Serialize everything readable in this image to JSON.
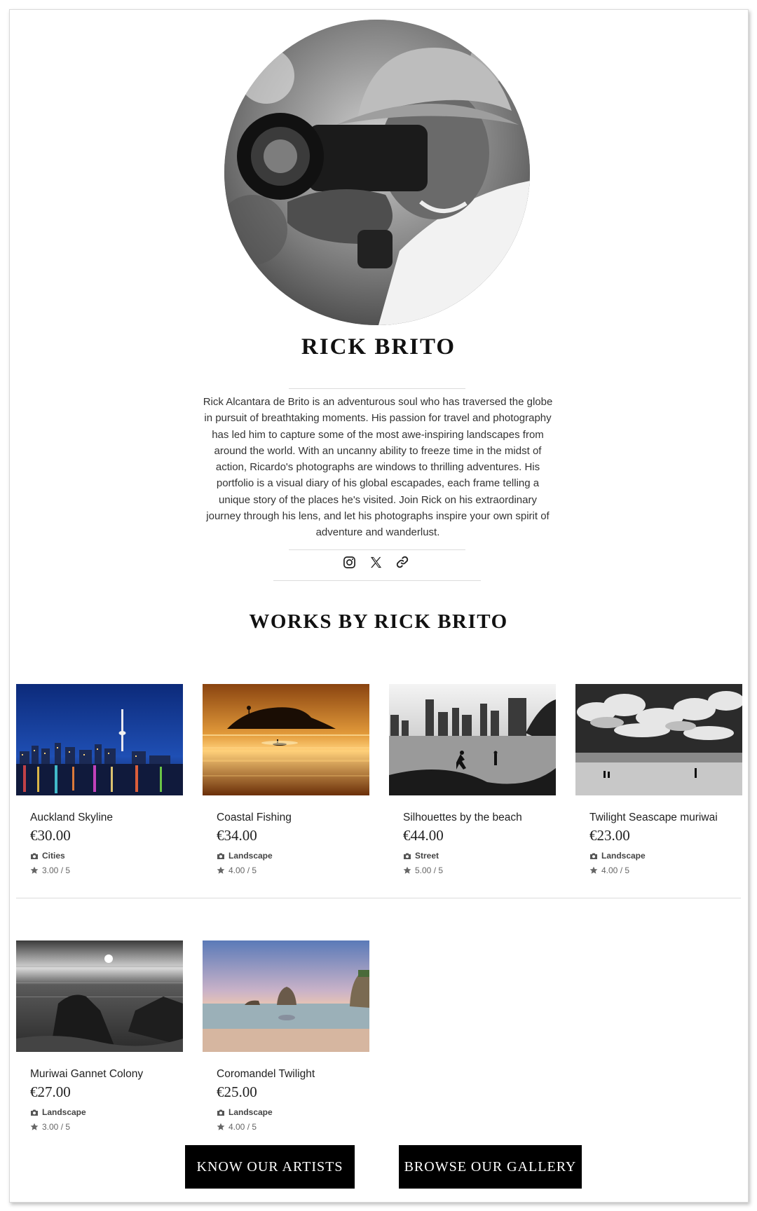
{
  "artist": {
    "name": "RICK BRITO",
    "bio": "Rick Alcantara de Brito is an adventurous soul who has traversed the globe in pursuit of breathtaking moments. His passion for travel and photography has led him to capture some of the most awe-inspiring landscapes from around the world. With an uncanny ability to freeze time in the midst of action, Ricardo's photographs are windows to thrilling adventures. His portfolio is a visual diary of his global escapades, each frame telling a unique story of the places he's visited. Join Rick on his extraordinary journey through his lens, and let his photographs inspire your own spirit of adventure and wanderlust.",
    "socials": [
      {
        "icon": "instagram-icon"
      },
      {
        "icon": "x-twitter-icon"
      },
      {
        "icon": "link-icon"
      }
    ]
  },
  "works_title": "WORKS BY RICK BRITO",
  "works": [
    {
      "title": "Auckland Skyline",
      "price": "€30.00",
      "category": "Cities",
      "rating": "3.00 / 5"
    },
    {
      "title": "Coastal Fishing",
      "price": "€34.00",
      "category": "Landscape",
      "rating": "4.00 / 5"
    },
    {
      "title": "Silhouettes by the beach",
      "price": "€44.00",
      "category": "Street",
      "rating": "5.00 / 5"
    },
    {
      "title": "Twilight Seascape muriwai",
      "price": "€23.00",
      "category": "Landscape",
      "rating": "4.00 / 5"
    },
    {
      "title": "Muriwai Gannet Colony",
      "price": "€27.00",
      "category": "Landscape",
      "rating": "3.00 / 5"
    },
    {
      "title": "Coromandel Twilight",
      "price": "€25.00",
      "category": "Landscape",
      "rating": "4.00 / 5"
    }
  ],
  "buttons": {
    "artists": "KNOW OUR ARTISTS",
    "gallery": "BROWSE OUR GALLERY"
  },
  "colors": {
    "button_bg": "#000000",
    "button_text": "#ffffff",
    "divider": "#dcdcdc"
  }
}
